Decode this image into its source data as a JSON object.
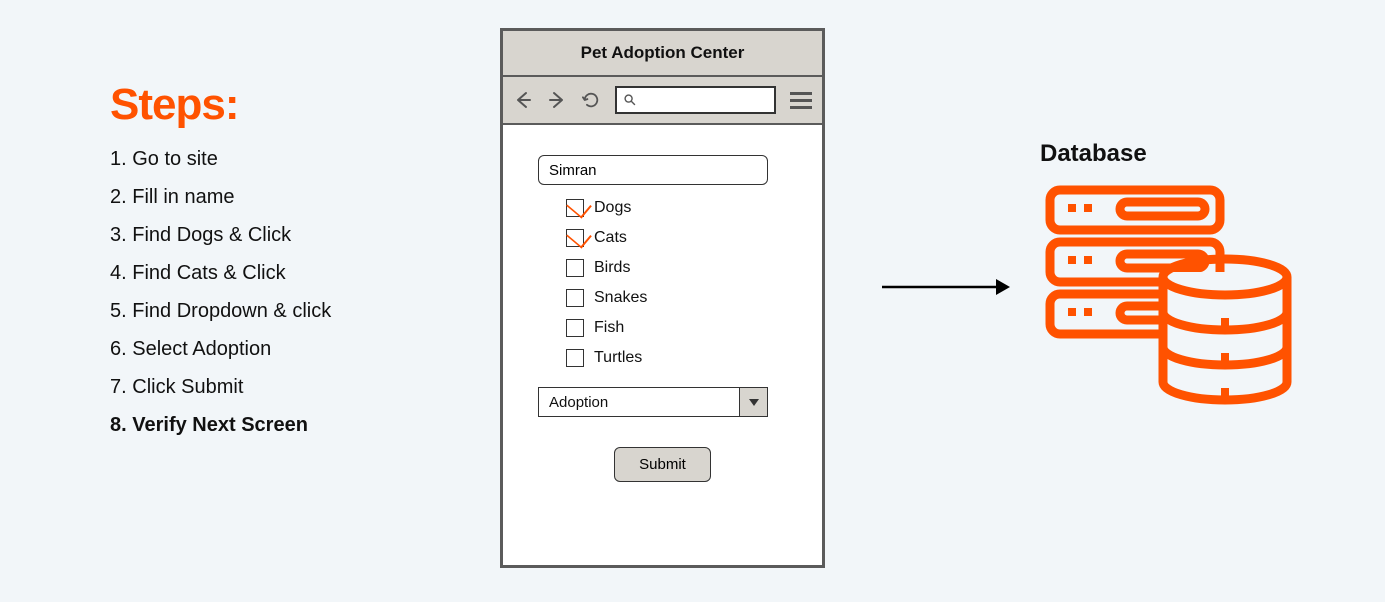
{
  "steps": {
    "title": "Steps:",
    "items": [
      {
        "label": "Go to site",
        "bold": false
      },
      {
        "label": "Fill in name",
        "bold": false
      },
      {
        "label": "Find Dogs & Click",
        "bold": false
      },
      {
        "label": "Find Cats & Click",
        "bold": false
      },
      {
        "label": "Find Dropdown & click",
        "bold": false
      },
      {
        "label": "Select Adoption",
        "bold": false
      },
      {
        "label": "Click Submit",
        "bold": false
      },
      {
        "label": "Verify Next Screen",
        "bold": true
      }
    ]
  },
  "phone": {
    "title": "Pet Adoption Center",
    "name_value": "Simran",
    "checks": [
      {
        "label": "Dogs",
        "checked": true
      },
      {
        "label": "Cats",
        "checked": true
      },
      {
        "label": "Birds",
        "checked": false
      },
      {
        "label": "Snakes",
        "checked": false
      },
      {
        "label": "Fish",
        "checked": false
      },
      {
        "label": "Turtles",
        "checked": false
      }
    ],
    "dropdown_value": "Adoption",
    "submit_label": "Submit"
  },
  "database": {
    "title": "Database"
  },
  "colors": {
    "accent": "#ff5200"
  }
}
